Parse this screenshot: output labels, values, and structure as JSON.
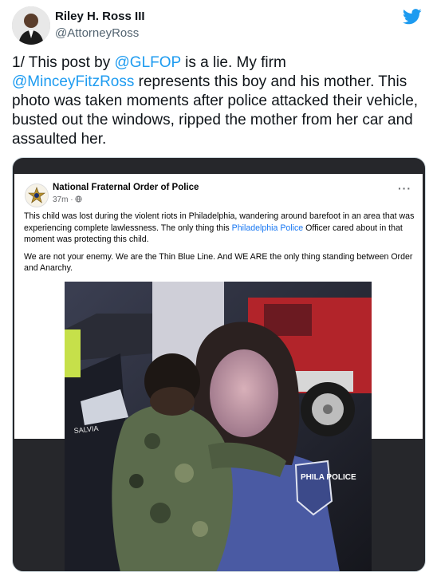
{
  "author": {
    "display_name": "Riley H. Ross III",
    "handle": "@AttorneyRoss"
  },
  "tweet": {
    "parts": [
      {
        "text": "1/ This post by ",
        "type": "text"
      },
      {
        "text": "@GLFOP",
        "type": "mention"
      },
      {
        "text": " is a lie. My firm\n",
        "type": "text"
      },
      {
        "text": "@MinceyFitzRoss",
        "type": "mention"
      },
      {
        "text": " represents this boy and his mother. This photo was taken moments after police attacked their vehicle, busted out the windows, ripped the mother from her car and assaulted her.",
        "type": "text"
      }
    ]
  },
  "embedded_post": {
    "page_name": "National Fraternal Order of Police",
    "time": "37m",
    "paragraph1_a": "This child was lost during the violent riots in Philadelphia, wandering around barefoot in an area that was experiencing complete lawlessness. The only thing this ",
    "paragraph1_link": "Philadelphia Police",
    "paragraph1_b": " Officer cared about in that moment was protecting this child.",
    "paragraph2": "We are not your enemy. We are the Thin Blue Line. And WE ARE the only thing standing between Order and Anarchy."
  },
  "photo": {
    "uniform_nametag": "SALVIA",
    "patch_text": "PHILA POLICE"
  },
  "icons": {
    "brand": "twitter-bird-icon",
    "visibility": "globe-icon",
    "more": "more-options-icon"
  },
  "colors": {
    "mention": "#1d9bf0",
    "facebook_link": "#1877f2",
    "name_text": "#0f1419",
    "secondary_text": "#536471"
  }
}
